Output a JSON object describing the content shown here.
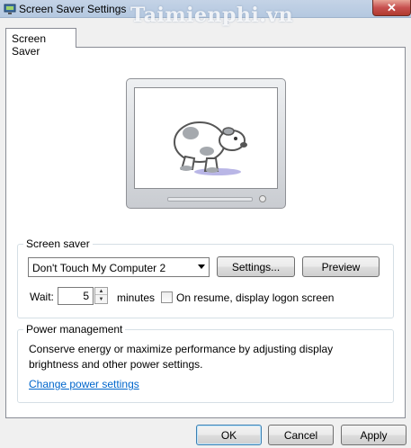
{
  "window": {
    "title": "Screen Saver Settings",
    "watermark": "Taimienphi.vn",
    "close_glyph": "✕"
  },
  "tabs": [
    {
      "label": "Screen Saver",
      "active": true
    }
  ],
  "preview": {
    "icon": "sheep-icon"
  },
  "screen_saver": {
    "group_label": "Screen saver",
    "selected": "Don't Touch My Computer 2",
    "settings_label": "Settings...",
    "preview_label": "Preview",
    "wait_label": "Wait:",
    "wait_value": "5",
    "minutes_label": "minutes",
    "resume_checkbox_label": "On resume, display logon screen",
    "resume_checked": false
  },
  "power": {
    "group_label": "Power management",
    "description": "Conserve energy or maximize performance by adjusting display brightness and other power settings.",
    "link_label": "Change power settings"
  },
  "footer": {
    "ok_label": "OK",
    "cancel_label": "Cancel",
    "apply_label": "Apply"
  },
  "colors": {
    "link": "#0066cc",
    "titlebar": "#b4c8e0",
    "close_button": "#c75050"
  }
}
